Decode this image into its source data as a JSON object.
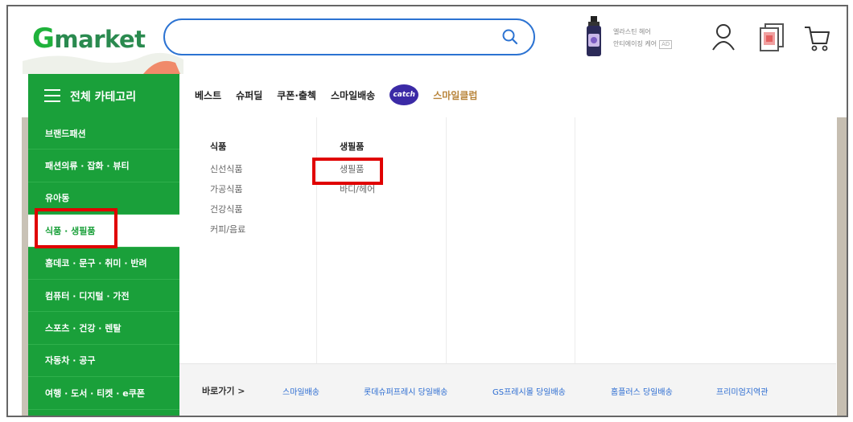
{
  "header": {
    "logo_g": "G",
    "logo_rest": "market",
    "search": {
      "value": "",
      "placeholder": ""
    },
    "ad": {
      "line1": "엘라스틴 헤어",
      "line2": "안티에이징 케어",
      "tag": "AD"
    }
  },
  "nav": {
    "all_categories": "전체 카테고리",
    "items": [
      "베스트",
      "슈퍼딜",
      "쿠폰·출첵",
      "스마일배송"
    ],
    "catch_label": "catch",
    "club": "스마일클럽"
  },
  "sidebar": {
    "items": [
      "브랜드패션",
      "패션의류 · 잡화 · 뷰티",
      "유아동",
      "식품 · 생필품",
      "홈데코 · 문구 · 취미 · 반려",
      "컴퓨터 · 디지털 · 가전",
      "스포츠 · 건강 · 렌탈",
      "자동차 · 공구",
      "여행 · 도서 · 티켓 · e쿠폰"
    ],
    "active_index": 3
  },
  "dropdown": {
    "col1": {
      "title": "식품",
      "links": [
        "신선식품",
        "가공식품",
        "건강식품",
        "커피/음료"
      ]
    },
    "col2": {
      "title": "생필품",
      "links": [
        "생필품",
        "바디/헤어"
      ]
    }
  },
  "shortcut": {
    "label": "바로가기 >",
    "links": [
      "스마일배송",
      "롯데슈퍼프레시 당일배송",
      "GS프레시몰 당일배송",
      "홈플러스 당일배송",
      "프리미엄지역관"
    ]
  },
  "colors": {
    "brand_green": "#1aa03a",
    "search_blue": "#2c73d2",
    "highlight_red": "#e00000",
    "link_blue": "#2a6bd1",
    "club_gold": "#b8843a"
  },
  "icons": [
    "search-icon",
    "user-icon",
    "recent-items-icon",
    "cart-icon",
    "hamburger-icon"
  ]
}
